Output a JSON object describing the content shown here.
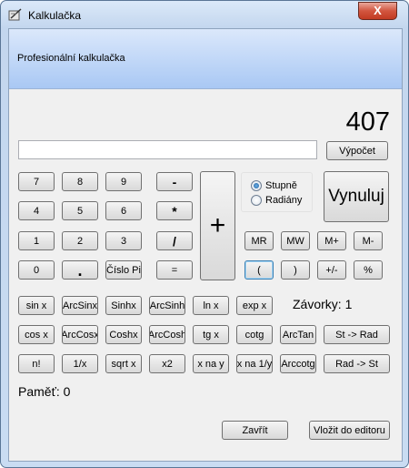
{
  "window": {
    "title": "Kalkulačka",
    "close_label": "X"
  },
  "header": {
    "title": "Profesionální kalkulačka"
  },
  "display": {
    "value": "407",
    "expression": ""
  },
  "buttons": {
    "compute": "Výpočet",
    "reset": "Vynuluj",
    "plus": "+",
    "digits": [
      "7",
      "8",
      "9",
      "4",
      "5",
      "6",
      "1",
      "2",
      "3",
      "0"
    ],
    "dot": ".",
    "pi": "Číslo Pi",
    "minus": "-",
    "multiply": "*",
    "divide": "/",
    "equals": "=",
    "mr": "MR",
    "mw": "MW",
    "mplus": "M+",
    "mminus": "M-",
    "open_paren": "(",
    "close_paren": ")",
    "sign": "+/-",
    "percent": "%",
    "sci_row1": [
      "sin x",
      "ArcSinx",
      "Sinhx",
      "ArcSinh",
      "ln x",
      "exp x"
    ],
    "sci_row2": [
      "cos x",
      "ArcCosx",
      "Coshx",
      "ArcCosh",
      "tg x",
      "cotg",
      "ArcTan",
      "St -> Rad"
    ],
    "sci_row3": [
      "n!",
      "1/x",
      "sqrt x",
      "x2",
      "x na y",
      "x na 1/y",
      "Arccotg",
      "Rad -> St"
    ],
    "close": "Zavřít",
    "to_editor": "Vložit do editoru"
  },
  "angle_mode": {
    "options": [
      "Stupně",
      "Radiány"
    ],
    "selected": "Stupně"
  },
  "brackets_label": "Závorky: 1",
  "memory_label": "Paměť: 0"
}
